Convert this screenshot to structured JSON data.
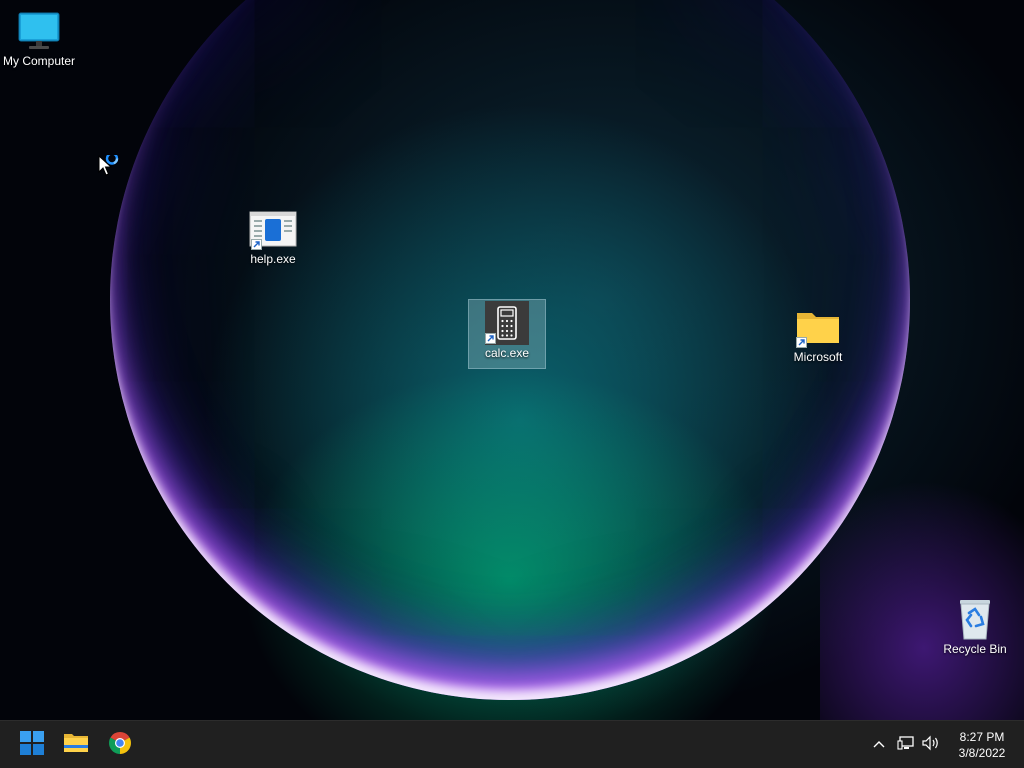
{
  "desktop": {
    "icons": {
      "my_computer": "My Computer",
      "help": "help.exe",
      "calc": "calc.exe",
      "microsoft": "Microsoft",
      "recycle_bin": "Recycle Bin"
    }
  },
  "taskbar": {
    "clock": {
      "time": "8:27 PM",
      "date": "3/8/2022"
    }
  },
  "icon_names": {
    "start": "windows-start-icon",
    "explorer": "file-explorer-icon",
    "chrome": "chrome-icon",
    "tray_chevron": "chevron-up-icon",
    "network": "network-icon",
    "volume": "volume-icon"
  },
  "colors": {
    "accent": "#1e90ff",
    "taskbar": "#202020",
    "folder": "#ffd24a"
  }
}
